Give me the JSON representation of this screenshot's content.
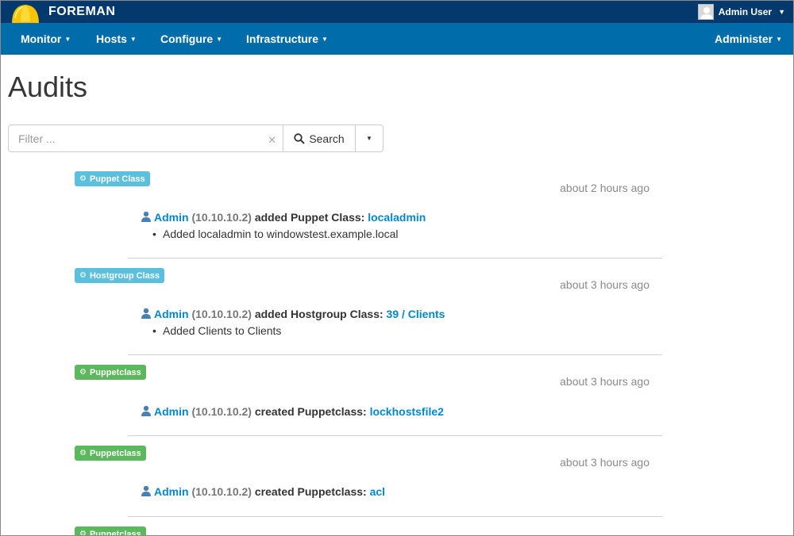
{
  "app": {
    "brand": "FOREMAN",
    "user_name": "Admin User"
  },
  "nav": {
    "left": [
      {
        "label": "Monitor"
      },
      {
        "label": "Hosts"
      },
      {
        "label": "Configure"
      },
      {
        "label": "Infrastructure"
      }
    ],
    "right": {
      "label": "Administer"
    }
  },
  "page": {
    "title": "Audits"
  },
  "search": {
    "placeholder": "Filter ...",
    "button_label": "Search"
  },
  "colors": {
    "topbar": "#03396c",
    "navbar": "#006daa",
    "badge_info": "#5bc0de",
    "badge_success": "#5cb85c",
    "link": "#0088ce"
  },
  "audits": [
    {
      "badge": "Puppet Class",
      "badge_style": "info",
      "time": "about 2 hours ago",
      "user": "Admin",
      "ip": "(10.10.10.2)",
      "action": "added Puppet Class:",
      "target": "localadmin",
      "detail": "Added localadmin to windowstest.example.local"
    },
    {
      "badge": "Hostgroup Class",
      "badge_style": "info",
      "time": "about 3 hours ago",
      "user": "Admin",
      "ip": "(10.10.10.2)",
      "action": "added Hostgroup Class:",
      "target": "39 / Clients",
      "detail": "Added Clients to Clients"
    },
    {
      "badge": "Puppetclass",
      "badge_style": "success",
      "time": "about 3 hours ago",
      "user": "Admin",
      "ip": "(10.10.10.2)",
      "action": "created Puppetclass:",
      "target": "lockhostsfile2"
    },
    {
      "badge": "Puppetclass",
      "badge_style": "success",
      "time": "about 3 hours ago",
      "user": "Admin",
      "ip": "(10.10.10.2)",
      "action": "created Puppetclass:",
      "target": "acl"
    },
    {
      "badge": "Puppetclass",
      "badge_style": "success"
    }
  ]
}
